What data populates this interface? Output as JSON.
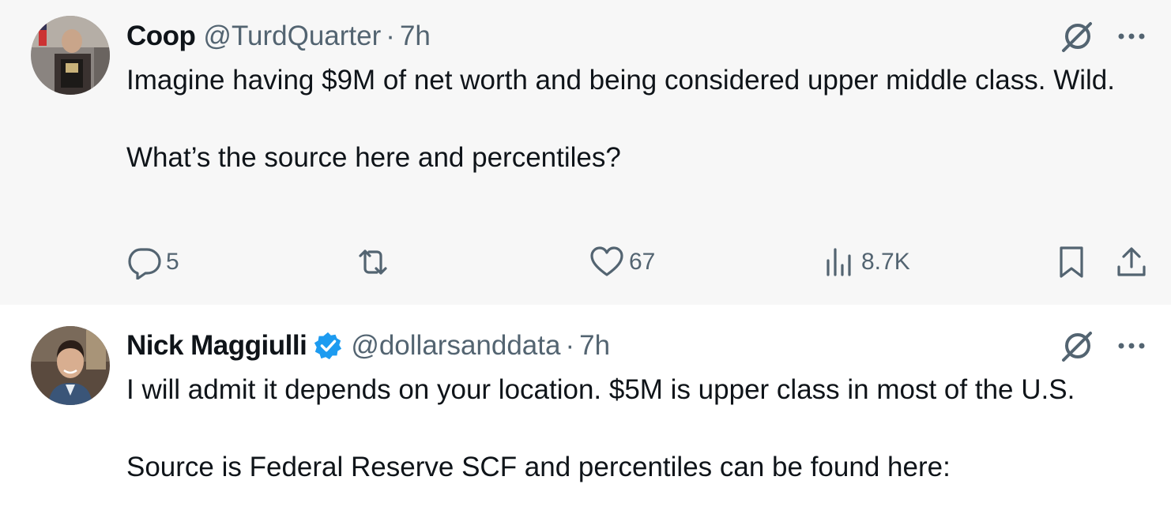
{
  "tweets": [
    {
      "display_name": "Coop",
      "handle": "@TurdQuarter",
      "separator": "·",
      "time": "7h",
      "body": [
        "Imagine having $9M of net worth and being considered upper middle class. Wild.",
        "",
        "What’s the source here and percentiles?"
      ],
      "actions": {
        "replies": "5",
        "reposts": "",
        "likes": "67",
        "views": "8.7K"
      }
    },
    {
      "display_name": "Nick Maggiulli",
      "verified": true,
      "handle": "@dollarsanddata",
      "separator": "·",
      "time": "7h",
      "body": [
        "I will admit it depends on your location. $5M is upper class in most of the U.S.",
        "",
        "Source is Federal Reserve SCF and percentiles can be found here:"
      ]
    }
  ],
  "icons": {
    "reply": "reply-bubble-icon",
    "repost": "repost-arrows-icon",
    "like": "heart-icon",
    "views": "bar-chart-icon",
    "bookmark": "bookmark-icon",
    "share": "share-upload-icon",
    "grok": "grok-slash-circle-icon",
    "more": "ellipsis-icon",
    "verified": "verified-badge-icon"
  },
  "colors": {
    "text": "#0f1419",
    "muted": "#536471",
    "verified": "#1d9bf0",
    "highlight_bg": "#f7f7f7",
    "thread_line": "#cfd9de"
  }
}
